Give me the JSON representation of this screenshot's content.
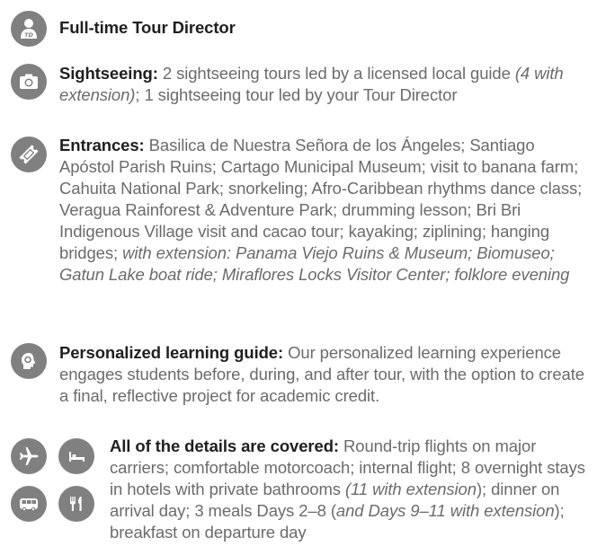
{
  "director": {
    "label": "Full-time Tour Director"
  },
  "sightseeing": {
    "label": "Sightseeing:",
    "text1": " 2 sightseeing tours led by a licensed local guide ",
    "em1": "(4 with extension)",
    "text2": "; 1 sightseeing tour led by your Tour Director"
  },
  "entrances": {
    "label": "Entrances:",
    "text1": " Basilica de Nuestra Señora de los Ángeles; Santiago Apóstol Parish Ruins; Cartago Municipal Museum; visit to banana farm; Cahuita National Park; snorkeling; Afro-Caribbean rhythms dance class; Veragua Rainforest & Adventure Park; drumming lesson; Bri Bri Indigenous Village visit and cacao tour; kayaking; ziplining; hanging bridges; ",
    "em1": "with extension: Panama Viejo Ruins & Museum; Biomuseo; Gatun Lake boat ride; Miraflores Locks Visitor Center; folklore evening"
  },
  "learning": {
    "label": "Personalized learning guide:",
    "text1": " Our personalized learning experience engages students before, during, and after tour, with the option to create a final, reflective project for academic credit."
  },
  "details": {
    "label": "All of the details are covered:",
    "text1": " Round-trip flights on major carriers; comfortable motorcoach; internal flight; 8 overnight stays in hotels with private bathrooms ",
    "em1": "(11 with extension",
    "text2": "); dinner on arrival day; 3 meals Days 2–8 (",
    "em2": "and Days 9–11 with extension",
    "text3": "); breakfast on departure day"
  },
  "icons": {
    "color": "#808080",
    "director": "tour-director-icon",
    "sightseeing": "camera-icon",
    "entrances": "ticket-icon",
    "learning": "head-icon",
    "flights": "airplane-icon",
    "hotel": "bed-icon",
    "coach": "bus-icon",
    "meals": "utensils-icon"
  }
}
